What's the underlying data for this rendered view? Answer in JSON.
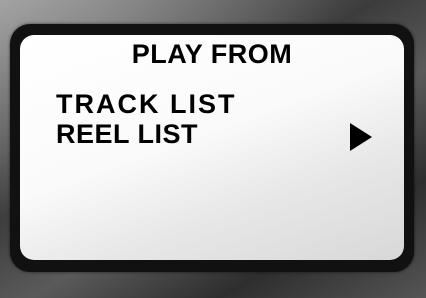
{
  "display": {
    "title": "PLAY FROM",
    "items": [
      {
        "label": "TRACK LIST"
      },
      {
        "label": "REEL LIST",
        "selected": true
      }
    ],
    "selection_indicator": "play-arrow-icon"
  },
  "colors": {
    "screen": "#f4f4f4",
    "text": "#000000",
    "frame": "#111111",
    "bezel": "#5a5a5a"
  }
}
